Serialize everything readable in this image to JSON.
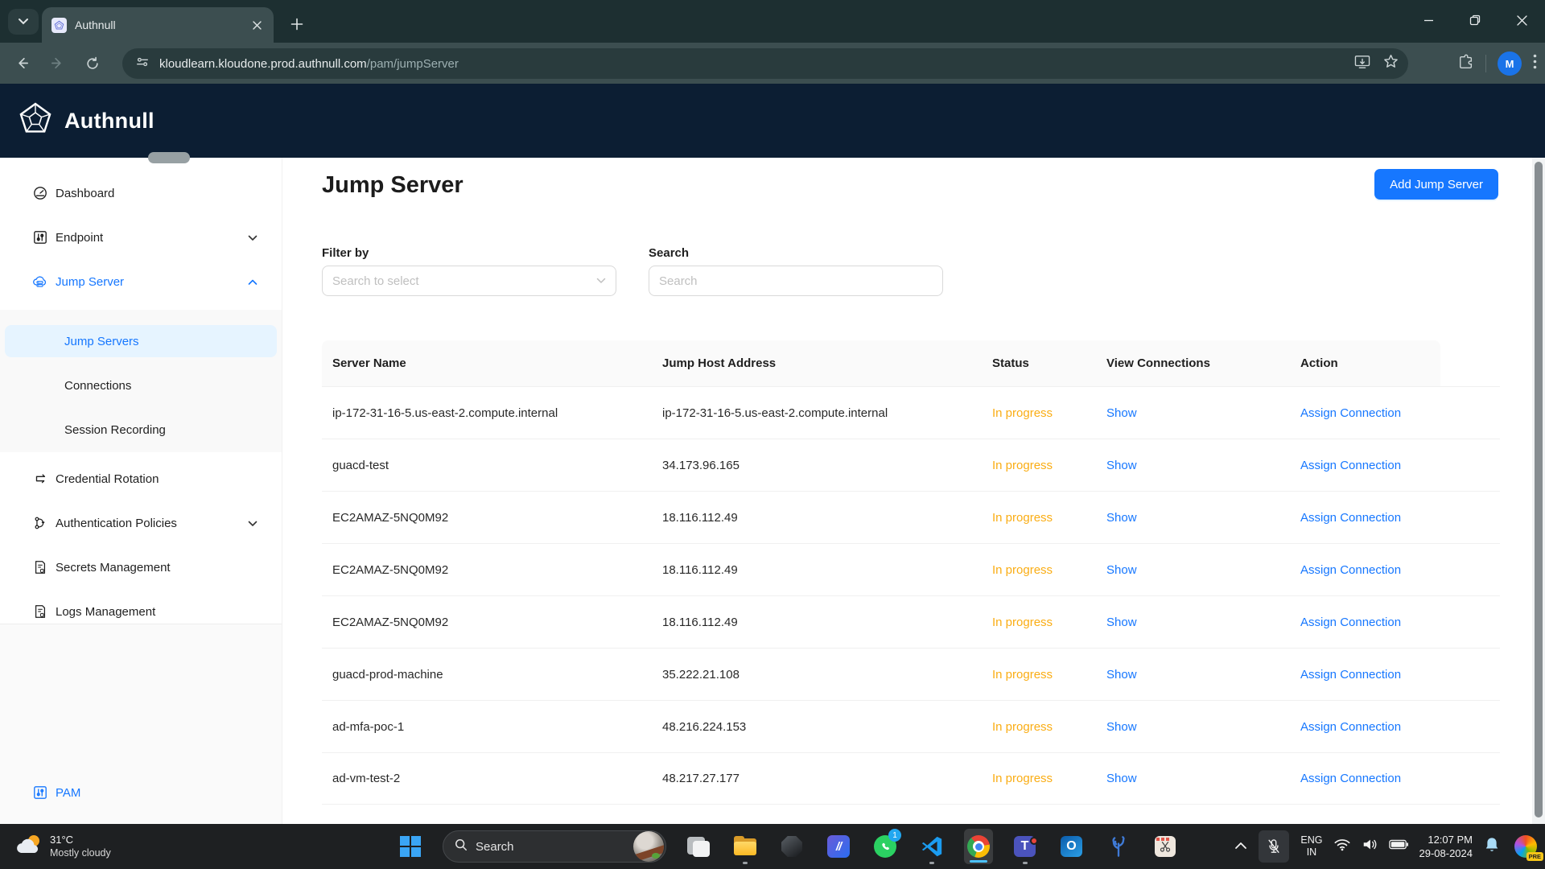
{
  "browser": {
    "tab_title": "Authnull",
    "url_domain": "kloudlearn.kloudone.prod.authnull.com",
    "url_path": "/pam/jumpServer",
    "profile_initial": "M"
  },
  "app": {
    "brand": "Authnull"
  },
  "sidebar": {
    "items": [
      {
        "label": "Dashboard"
      },
      {
        "label": "Endpoint"
      },
      {
        "label": "Jump Server"
      },
      {
        "label": "Jump Servers"
      },
      {
        "label": "Connections"
      },
      {
        "label": "Session Recording"
      },
      {
        "label": "Credential Rotation"
      },
      {
        "label": "Authentication Policies"
      },
      {
        "label": "Secrets Management"
      },
      {
        "label": "Logs Management"
      }
    ],
    "footer_label": "PAM"
  },
  "page": {
    "title": "Jump Server",
    "add_button_label": "Add Jump Server",
    "filter_label": "Filter by",
    "filter_placeholder": "Search to select",
    "search_label": "Search",
    "search_placeholder": "Search"
  },
  "table": {
    "columns": [
      "Server Name",
      "Jump Host Address",
      "Status",
      "View Connections",
      "Action"
    ],
    "rows": [
      {
        "server_name": "ip-172-31-16-5.us-east-2.compute.internal",
        "jump_host_address": "ip-172-31-16-5.us-east-2.compute.internal",
        "status": "In progress",
        "view_connections": "Show",
        "action": "Assign Connection"
      },
      {
        "server_name": "guacd-test",
        "jump_host_address": "34.173.96.165",
        "status": "In progress",
        "view_connections": "Show",
        "action": "Assign Connection"
      },
      {
        "server_name": "EC2AMAZ-5NQ0M92",
        "jump_host_address": "18.116.112.49",
        "status": "In progress",
        "view_connections": "Show",
        "action": "Assign Connection"
      },
      {
        "server_name": "EC2AMAZ-5NQ0M92",
        "jump_host_address": "18.116.112.49",
        "status": "In progress",
        "view_connections": "Show",
        "action": "Assign Connection"
      },
      {
        "server_name": "EC2AMAZ-5NQ0M92",
        "jump_host_address": "18.116.112.49",
        "status": "In progress",
        "view_connections": "Show",
        "action": "Assign Connection"
      },
      {
        "server_name": "guacd-prod-machine",
        "jump_host_address": "35.222.21.108",
        "status": "In progress",
        "view_connections": "Show",
        "action": "Assign Connection"
      },
      {
        "server_name": "ad-mfa-poc-1",
        "jump_host_address": "48.216.224.153",
        "status": "In progress",
        "view_connections": "Show",
        "action": "Assign Connection"
      },
      {
        "server_name": "ad-vm-test-2",
        "jump_host_address": "48.217.27.177",
        "status": "In progress",
        "view_connections": "Show",
        "action": "Assign Connection"
      }
    ]
  },
  "colors": {
    "accent_blue": "#1677ff",
    "status_orange": "#faad14",
    "header_navy": "#0c1e33"
  },
  "taskbar": {
    "weather_temp": "31°C",
    "weather_condition": "Mostly cloudy",
    "search_placeholder": "Search",
    "whatsapp_badge": "1",
    "language_line1": "ENG",
    "language_line2": "IN",
    "time": "12:07 PM",
    "date": "29-08-2024",
    "copilot_badge": "PRE"
  }
}
